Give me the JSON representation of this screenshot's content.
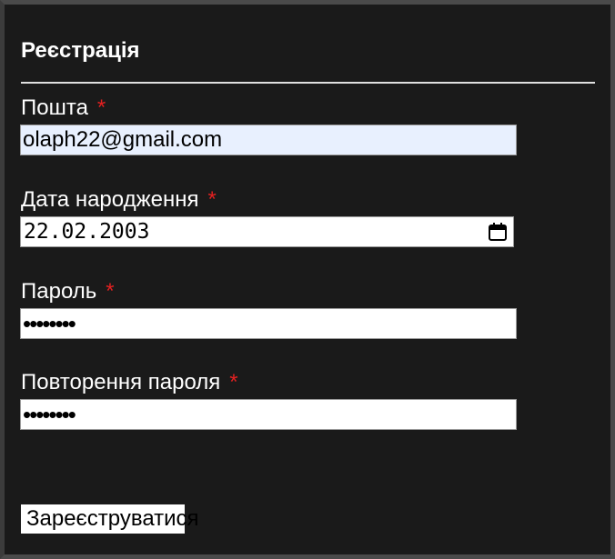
{
  "form": {
    "title": "Реєстрація",
    "required_marker": "*",
    "email": {
      "label": "Пошта",
      "value": "olaph22@gmail.com"
    },
    "birthdate": {
      "label": "Дата народження",
      "value": "22.02.2003",
      "icon": "calendar-icon"
    },
    "password": {
      "label": "Пароль",
      "value": "••••••••"
    },
    "password_repeat": {
      "label": "Повторення пароля",
      "value": "••••••••"
    },
    "submit_label": "Зареєструватися"
  },
  "colors": {
    "background": "#1a1a1a",
    "required": "#e32020",
    "autofill": "#e8f0fe"
  }
}
